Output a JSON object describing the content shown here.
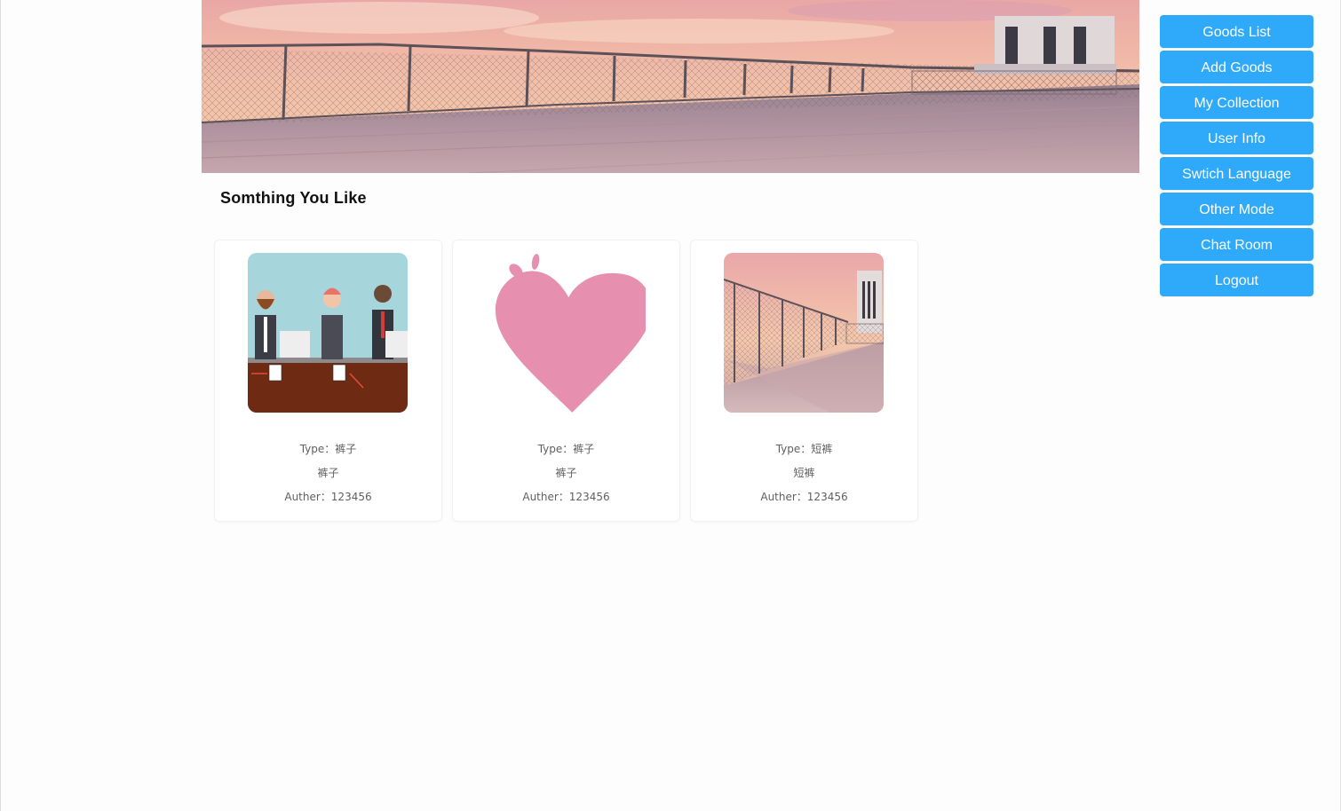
{
  "section": {
    "title": "Somthing You Like"
  },
  "menu": {
    "items": [
      {
        "label": "Goods List"
      },
      {
        "label": "Add Goods"
      },
      {
        "label": "My Collection"
      },
      {
        "label": "User Info"
      },
      {
        "label": "Swtich Language"
      },
      {
        "label": "Other Mode"
      },
      {
        "label": "Chat Room"
      },
      {
        "label": "Logout"
      }
    ]
  },
  "products": [
    {
      "type": "Type：裤子",
      "name": "裤子",
      "author": "Auther：123456",
      "image": "office-workers-illustration"
    },
    {
      "type": "Type：裤子",
      "name": "裤子",
      "author": "Auther：123456",
      "image": "pink-heart-illustration"
    },
    {
      "type": "Type：短裤",
      "name": "短裤",
      "author": "Auther：123456",
      "image": "rooftop-sunset-scene"
    }
  ],
  "colors": {
    "accent": "#2fa9fa",
    "heart": "#e78fae"
  }
}
